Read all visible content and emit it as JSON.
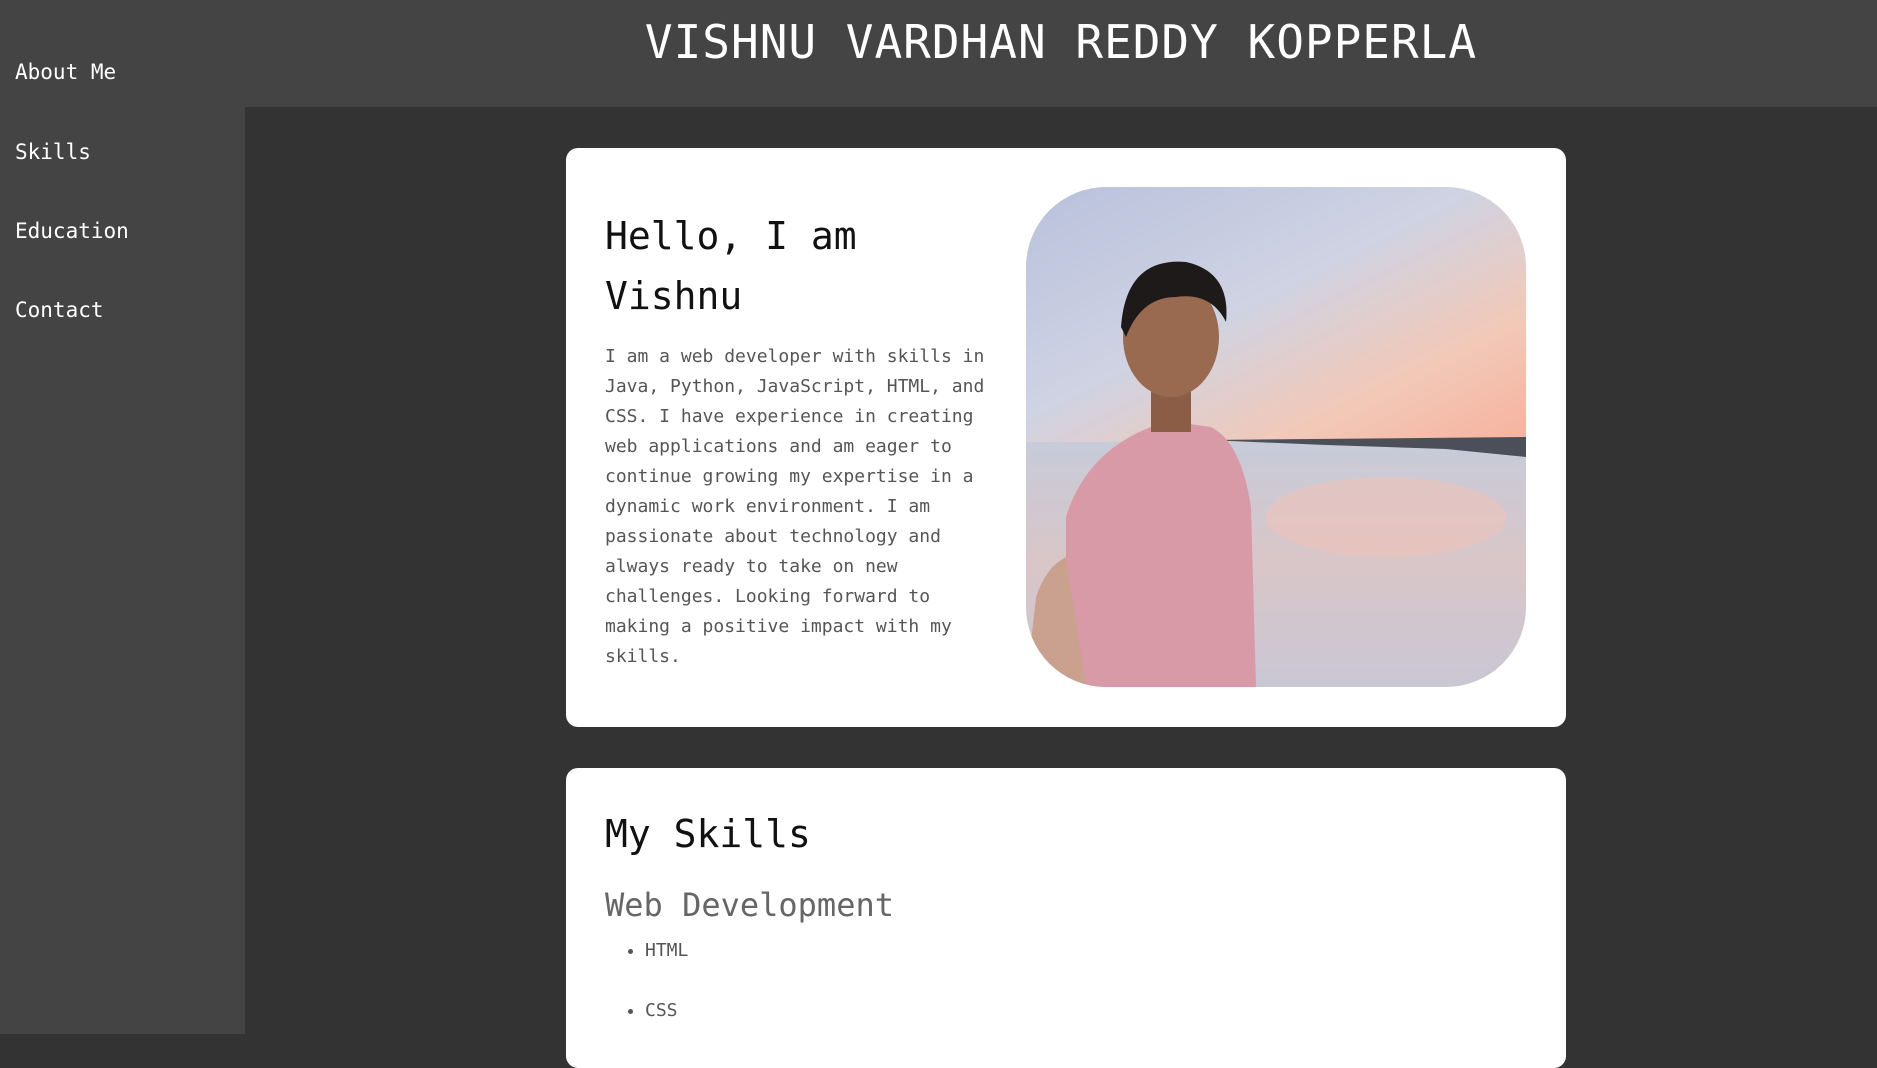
{
  "nav": {
    "items": [
      {
        "label": "About Me"
      },
      {
        "label": "Skills"
      },
      {
        "label": "Education"
      },
      {
        "label": "Contact"
      }
    ]
  },
  "header": {
    "title": "VISHNU VARDHAN REDDY KOPPERLA"
  },
  "about": {
    "heading": "Hello, I am Vishnu",
    "text": "I am a web developer with skills in Java, Python, JavaScript, HTML, and CSS. I have experience in creating web applications and am eager to continue growing my expertise in a dynamic work environment. I am passionate about technology and always ready to take on new challenges. Looking forward to making a positive impact with my skills.",
    "photo_alt": "Vishnu"
  },
  "skills": {
    "heading": "My Skills",
    "category": "Web Development",
    "items": [
      "HTML",
      "CSS"
    ]
  },
  "colors": {
    "page_background": "#333333",
    "sidebar_background": "#444444",
    "card_background": "#ffffff"
  }
}
